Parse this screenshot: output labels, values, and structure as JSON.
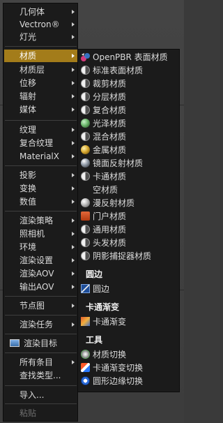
{
  "main_menu": {
    "items": [
      {
        "label": "几何体",
        "arrow": true
      },
      {
        "label": "Vectron®",
        "arrow": true
      },
      {
        "label": "灯光",
        "arrow": true
      },
      {
        "label": "材质",
        "arrow": true,
        "highlighted": true
      },
      {
        "label": "材质层",
        "arrow": true
      },
      {
        "label": "位移",
        "arrow": true
      },
      {
        "label": "辐射",
        "arrow": true
      },
      {
        "label": "媒体",
        "arrow": true
      },
      {
        "label": "纹理",
        "arrow": true
      },
      {
        "label": "复合纹理",
        "arrow": true
      },
      {
        "label": "MaterialX",
        "arrow": true
      },
      {
        "label": "投影",
        "arrow": true
      },
      {
        "label": "变换",
        "arrow": true
      },
      {
        "label": "数值",
        "arrow": true
      },
      {
        "label": "渲染策略",
        "arrow": true
      },
      {
        "label": "照相机",
        "arrow": true
      },
      {
        "label": "环境",
        "arrow": true
      },
      {
        "label": "渲染设置",
        "arrow": true
      },
      {
        "label": "渲染AOV",
        "arrow": true
      },
      {
        "label": "输出AOV",
        "arrow": true
      },
      {
        "label": "节点图",
        "arrow": true
      },
      {
        "label": "渲染任务",
        "arrow": true
      },
      {
        "label": "渲染目标",
        "arrow": false
      },
      {
        "label": "所有条目",
        "arrow": true
      },
      {
        "label": "查找类型...",
        "arrow": false
      },
      {
        "label": "导入...",
        "arrow": false
      },
      {
        "label": "粘贴",
        "arrow": false,
        "disabled": true
      }
    ]
  },
  "material_submenu": {
    "items": [
      {
        "label": "OpenPBR 表面材质",
        "icon": "openpbr-icon"
      },
      {
        "label": "标准表面材质",
        "icon": "standard-surface-icon"
      },
      {
        "label": "裁剪材质",
        "icon": "clipping-material-icon"
      },
      {
        "label": "分层材质",
        "icon": "layered-material-icon"
      },
      {
        "label": "复合材质",
        "icon": "composite-material-icon"
      },
      {
        "label": "光泽材质",
        "icon": "glossy-material-icon"
      },
      {
        "label": "混合材质",
        "icon": "mix-material-icon"
      },
      {
        "label": "金属材质",
        "icon": "metal-material-icon"
      },
      {
        "label": "镜面反射材质",
        "icon": "specular-material-icon"
      },
      {
        "label": "卡通材质",
        "icon": "toon-material-icon"
      },
      {
        "label": "空材质",
        "icon": ""
      },
      {
        "label": "漫反射材质",
        "icon": "diffuse-material-icon"
      },
      {
        "label": "门户材质",
        "icon": "portal-material-icon"
      },
      {
        "label": "通用材质",
        "icon": "universal-material-icon"
      },
      {
        "label": "头发材质",
        "icon": "hair-material-icon"
      },
      {
        "label": "阴影捕捉器材质",
        "icon": "shadow-catcher-icon"
      }
    ],
    "section_round_edges": {
      "header": "圆边",
      "item": "圆边"
    },
    "section_toon_ramp": {
      "header": "卡通渐变",
      "item": "卡通渐变"
    },
    "section_tools": {
      "header": "工具",
      "items": [
        "材质切换",
        "卡通渐变切换",
        "圆形边缘切换"
      ]
    }
  }
}
